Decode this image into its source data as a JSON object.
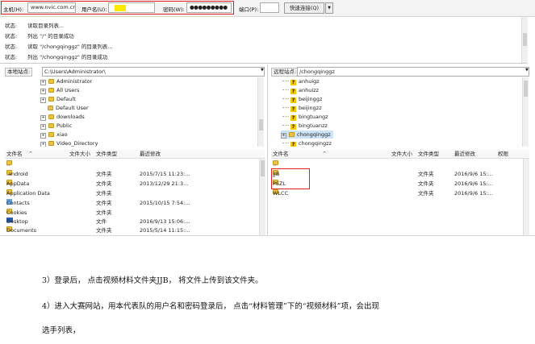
{
  "quickconnect": {
    "host_label": "主机(H):",
    "host_value": "www.nvic.com.cn",
    "user_label": "用户名(U):",
    "password_label": "密码(W):",
    "password_value": "●●●●●●●●●",
    "port_label": "端口(P):",
    "connect_button": "快速连接(Q)",
    "dropdown_glyph": "▼"
  },
  "status_log": [
    {
      "k": "状态:",
      "msg": "读取目录列表..."
    },
    {
      "k": "状态:",
      "msg": "列出 \"/\" 的目录成功"
    },
    {
      "k": "状态:",
      "msg": "读取 \"/chongqinggz\" 的目录列表..."
    },
    {
      "k": "状态:",
      "msg": "列出 \"/chongqinggz\" 的目录成功"
    }
  ],
  "local_site": {
    "label": "本地站点:",
    "path": "C:\\Users\\Administrator\\",
    "tree": [
      "Administrator",
      "All Users",
      "Default",
      "Default User",
      "downloads",
      "Public",
      "xiao",
      "Video_Directory"
    ]
  },
  "remote_site": {
    "label": "远程站点:",
    "path": "/chongqinggz",
    "tree": [
      "anhuigz",
      "anhuizz",
      "beijinggz",
      "beijingzz",
      "bingtuangz",
      "bingtuanzz",
      "chongqinggz",
      "chongqingzz"
    ]
  },
  "local_files": {
    "columns": [
      "文件名",
      "文件大小",
      "文件类型",
      "最近修改"
    ],
    "rows": [
      {
        "name": "..",
        "size": "",
        "type": "",
        "mod": ""
      },
      {
        "name": ".android",
        "size": "",
        "type": "文件夹",
        "mod": "2015/7/15 11:23:..."
      },
      {
        "name": "AppData",
        "size": "",
        "type": "文件夹",
        "mod": "2013/12/29 21:3..."
      },
      {
        "name": "Application Data",
        "size": "",
        "type": "文件夹",
        "mod": ""
      },
      {
        "name": "Contacts",
        "size": "",
        "type": "文件夹",
        "mod": "2015/10/15 7:54:..."
      },
      {
        "name": "Cookies",
        "size": "",
        "type": "文件夹",
        "mod": ""
      },
      {
        "name": "Desktop",
        "size": "",
        "type": "文件",
        "mod": "2016/9/13 15:06:..."
      },
      {
        "name": "Documents",
        "size": "",
        "type": "文件夹",
        "mod": "2015/5/14 11:15:..."
      }
    ]
  },
  "remote_files": {
    "columns": [
      "文件名",
      "文件大小",
      "文件类型",
      "最近修改",
      "权限"
    ],
    "rows": [
      {
        "name": "..",
        "type": "",
        "mod": ""
      },
      {
        "name": "JJB",
        "type": "文件夹",
        "mod": "2016/9/6 15:..."
      },
      {
        "name": "PSZL",
        "type": "文件夹",
        "mod": "2016/9/6 15:..."
      },
      {
        "name": "WLCC",
        "type": "文件夹",
        "mod": "2016/9/6 15:..."
      }
    ]
  },
  "document": {
    "line1": "3）登录后，  点击视频材料文件夹JJB，  将文件上传到该文件夹。",
    "line2": "4）进入大赛网站，用本代表队的用户名和密码登录后，   点击“材料管理”下的“视频材料”项，会出现",
    "line3": "选手列表，"
  },
  "colors": {
    "highlight_box": "#e02020",
    "folder": "#e8c24a",
    "user_highlight": "#ffe800"
  }
}
